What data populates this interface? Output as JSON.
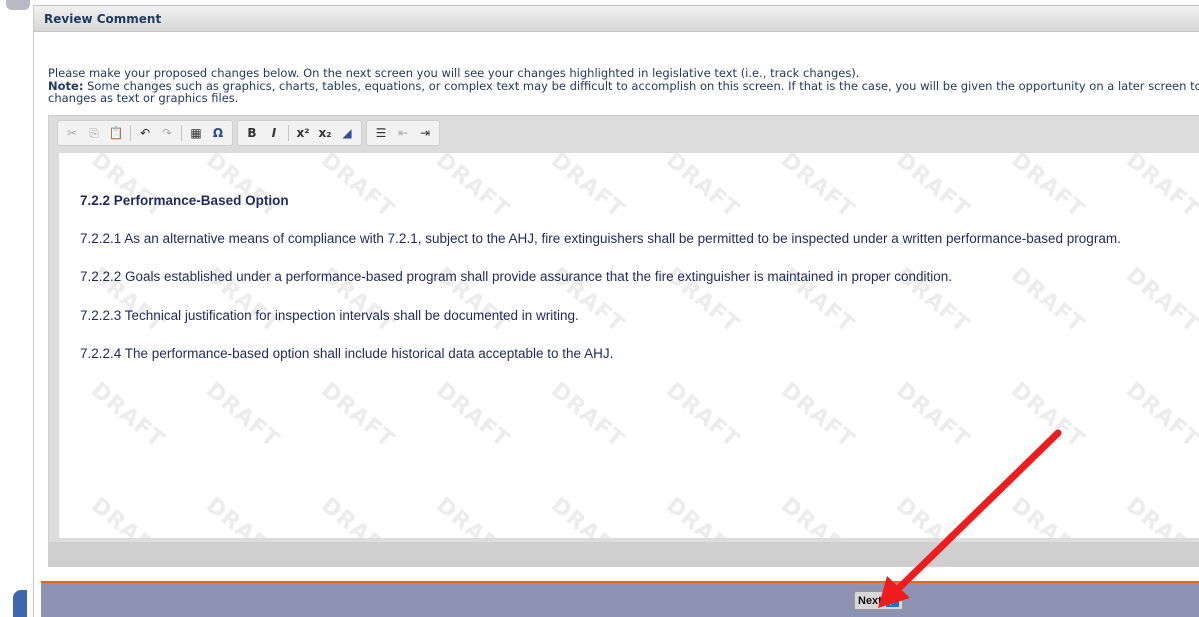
{
  "panel": {
    "title": "Review Comment"
  },
  "instructions": {
    "line1": "Please make your proposed changes below. On the next screen you will see your changes highlighted in legislative text (i.e., track changes).",
    "note_label": "Note:",
    "note_text": " Some changes such as graphics, charts, tables, equations, or complex text may be difficult to accomplish on this screen. If that is the case, you will be given the opportunity on a later screen to",
    "line3": "changes as text or graphics files."
  },
  "toolbar": {
    "groups": [
      [
        "cut-icon",
        "copy-icon",
        "paste-icon",
        "undo-icon",
        "redo-icon",
        "table-icon",
        "omega-icon"
      ],
      [
        "bold-icon",
        "italic-icon",
        "superscript-icon",
        "subscript-icon",
        "eraser-icon"
      ],
      [
        "numbered-list-icon",
        "outdent-icon",
        "indent-icon"
      ]
    ]
  },
  "watermark": {
    "text": "DRAFT"
  },
  "document": {
    "heading": "7.2.2 Performance-Based Option",
    "p1": "7.2.2.1 As an alternative means of compliance with 7.2.1, subject to the AHJ, fire extinguishers shall be permitted to be inspected under a written performance-based program.",
    "p2": "7.2.2.2 Goals established under a performance-based program shall provide assurance that the fire extinguisher is maintained in proper condition.",
    "p3": "7.2.2.3 Technical justification for inspection intervals shall be documented in writing.",
    "p4": "7.2.2.4 The performance-based option shall include historical data acceptable to the AHJ."
  },
  "footer": {
    "next_label": "Next"
  },
  "colors": {
    "accent_arrow": "#ee1c1c",
    "footer_bar": "#8e93b3",
    "footer_line": "#e06a1b",
    "next_icon": "#1c74c9"
  }
}
